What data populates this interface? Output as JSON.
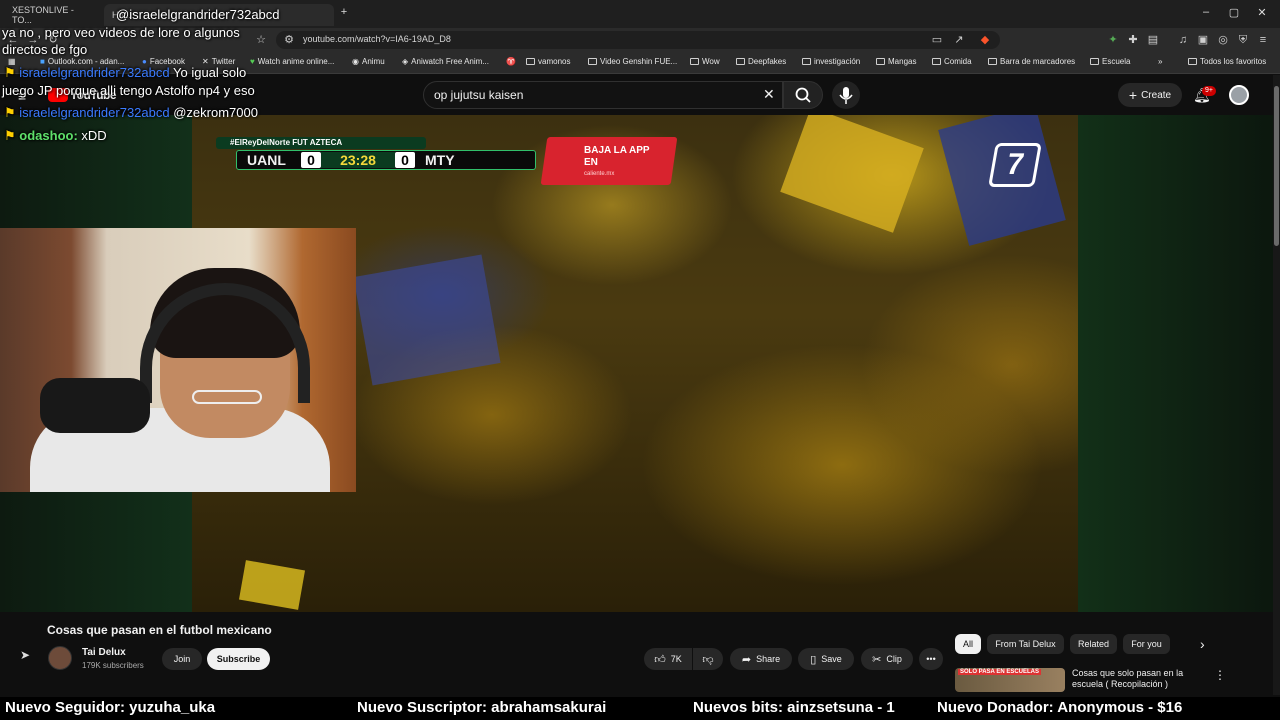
{
  "browser": {
    "tabs": [
      "XESTONLIVE - TO...",
      "Ho..."
    ],
    "url": "youtube.com/watch?v=IA6-19AD_D8",
    "bookmarks": [
      "Outlook.com - adan...",
      "Facebook",
      "Twitter",
      "Watch anime online...",
      "Animu",
      "Aniwatch Free Anim...",
      "vamonos",
      "Video Genshin FUE...",
      "Wow",
      "Deepfakes",
      "investigación",
      "Mangas",
      "Comida",
      "Barra de marcadores",
      "Escuela"
    ],
    "bookmarks_other": "Todos los favoritos"
  },
  "youtube": {
    "logo": "YouTube",
    "search_query": "op jujutsu kaisen",
    "create_label": "Create",
    "notif_count": "9+"
  },
  "video": {
    "score_tag": "#ElReyDelNorte  FUT AZTECA",
    "home_team": "UANL",
    "home_score": "0",
    "clock": "23:28",
    "away_score": "0",
    "away_team": "MTY",
    "app_banner": "BAJA LA APP EN",
    "app_banner_sub": "caliente.mx",
    "channel_bug": "7",
    "title": "Cosas que pasan en el futbol mexicano",
    "channel_name": "Tai Delux",
    "channel_subs": "179K subscribers",
    "join_label": "Join",
    "subscribe_label": "Subscribe",
    "likes": "7K",
    "share_label": "Share",
    "save_label": "Save",
    "clip_label": "Clip"
  },
  "chips": [
    "All",
    "From Tai Delux",
    "Related",
    "For you"
  ],
  "recommendation": {
    "thumb_label": "SOLO PASA EN ESCUELAS",
    "title": "Cosas que solo pasan en la escuela ( Recopilación )"
  },
  "chat": [
    {
      "user": "@israelelgrandrider732abcd",
      "message": ""
    },
    {
      "user": "",
      "message": "ya no , pero veo videos de lore o algunos"
    },
    {
      "user": "",
      "message": "directos de fgo"
    },
    {
      "user": "israelelgrandrider732abcd",
      "message": "Yo igual solo"
    },
    {
      "user": "",
      "message": "juego JP porque alli tengo Astolfo np4 y eso"
    },
    {
      "user": "israelelgrandrider732abcd",
      "message": "@zekrom7000"
    },
    {
      "user": "odashoo",
      "message": "xDD"
    }
  ],
  "ticker": [
    "Nuevo Seguidor: yuzuha_uka",
    "Nuevo Suscriptor: abrahamsakurai",
    "Nuevos bits: ainzsetsuna - 1",
    "Nuevo Donador: Anonymous - $16"
  ]
}
